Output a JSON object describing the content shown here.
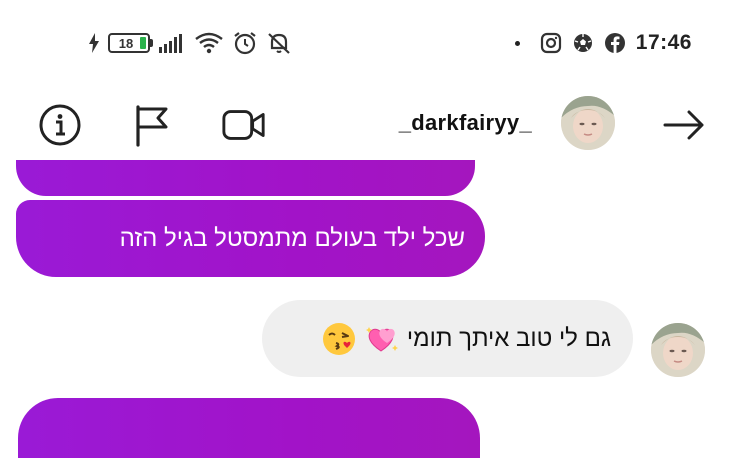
{
  "status_bar": {
    "battery_level": "18",
    "battery_charging": true,
    "time": "17:46",
    "left_icons": [
      "charging-bolt-icon",
      "battery-icon",
      "signal-icon",
      "wifi-icon",
      "alarm-icon",
      "muted-bell-icon"
    ],
    "right_icons": [
      "notification-dot-icon",
      "instagram-icon",
      "soccer-ball-icon",
      "facebook-icon"
    ]
  },
  "header": {
    "username": "_darkfairyy_",
    "icons": [
      "info-icon",
      "flag-icon",
      "video-call-icon",
      "back-arrow-icon"
    ]
  },
  "messages": [
    {
      "from": "other",
      "text": "שכל ילד בעולם מתמסטל בגיל הזה"
    },
    {
      "from": "me",
      "text": "גם לי טוב איתך תומי",
      "emojis": [
        "sparkling-heart-emoji",
        "kissing-face-emoji"
      ]
    }
  ],
  "colors": {
    "accent_purple": "#a015cc",
    "incoming_grey": "#efefef"
  }
}
